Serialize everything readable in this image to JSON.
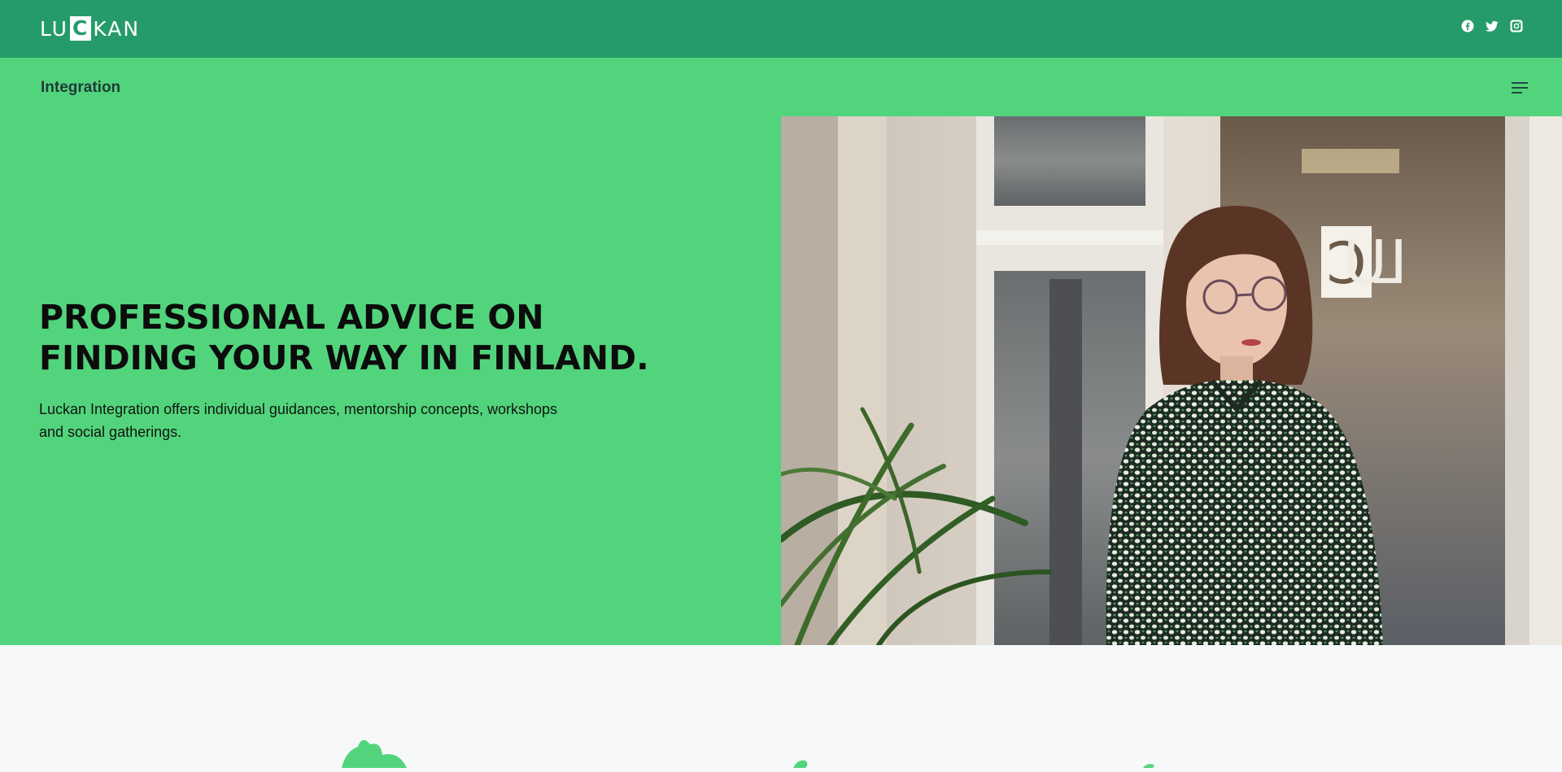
{
  "brand": {
    "logo_before": "LU",
    "logo_boxed": "C",
    "logo_after": "KAN"
  },
  "social": {
    "icons": [
      "facebook-icon",
      "twitter-icon",
      "instagram-icon"
    ]
  },
  "subnav": {
    "title": "Integration",
    "menu_icon": "hamburger-menu-icon"
  },
  "hero": {
    "headline": "PROFESSIONAL ADVICE ON\nFINDING YOUR WAY IN FINLAND.",
    "description": "Luckan Integration offers individual guidances, mentorship concepts, workshops and social gatherings.",
    "photo_sign_text": "LUCK"
  },
  "colors": {
    "topbar": "#259b6a",
    "hero_green": "#52d47c",
    "page_bg": "#f7f8fa"
  }
}
